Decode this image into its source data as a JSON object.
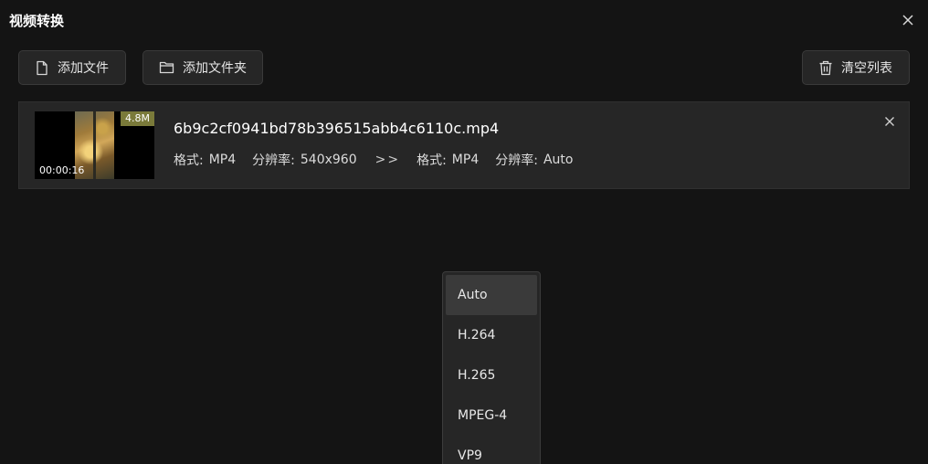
{
  "window": {
    "title": "视频转换"
  },
  "toolbar": {
    "add_file": "添加文件",
    "add_folder": "添加文件夹",
    "clear_list": "清空列表"
  },
  "files": [
    {
      "name": "6b9c2cf0941bd78b396515abb4c6110c.mp4",
      "size": "4.8M",
      "duration": "00:00:16",
      "source": {
        "format_label": "格式:",
        "format": "MP4",
        "resolution_label": "分辨率:",
        "resolution": "540x960"
      },
      "arrow": ">>",
      "target": {
        "format_label": "格式:",
        "format": "MP4",
        "resolution_label": "分辨率:",
        "resolution": "Auto"
      }
    }
  ],
  "codec_dropdown": {
    "selected": "Auto",
    "options": [
      "Auto",
      "H.264",
      "H.265",
      "MPEG-4",
      "VP9"
    ]
  },
  "colors": {
    "background": "#141414",
    "panel": "#262626",
    "size_badge": "#7a7a3a",
    "text": "#e6e6e6"
  },
  "icons": {
    "close": "close-icon",
    "file": "file-icon",
    "folder": "folder-icon",
    "trash": "trash-icon"
  }
}
